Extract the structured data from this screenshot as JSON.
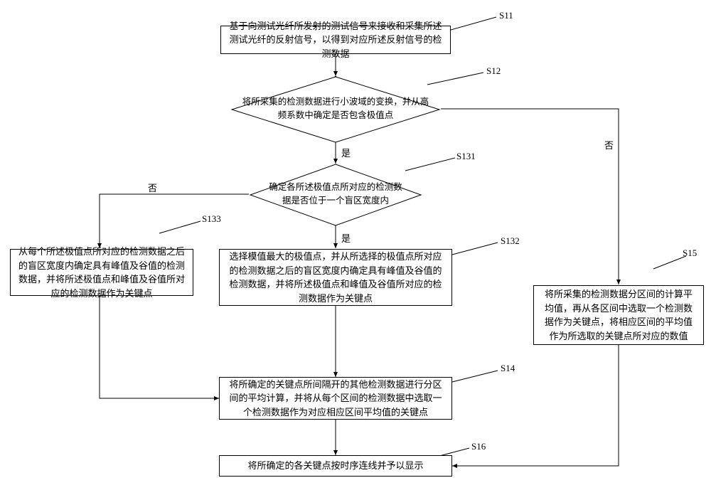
{
  "chart_data": {
    "type": "flowchart",
    "title": "",
    "nodes": [
      {
        "id": "S11",
        "type": "process",
        "label": "基于向测试光纤所发射的测试信号来接收和采集所述测试光纤的反射信号，以得到对应所述反射信号的检测数据"
      },
      {
        "id": "S12",
        "type": "decision",
        "label": "将所采集的检测数据进行小波域的变换，并从高频系数中确定是否包含极值点"
      },
      {
        "id": "S131",
        "type": "decision",
        "label": "确定各所述极值点所对应的检测数据是否位于一个盲区宽度内"
      },
      {
        "id": "S132",
        "type": "process",
        "label": "选择模值最大的极值点，并从所选择的极值点所对应的检测数据之后的盲区宽度内确定具有峰值及谷值的检测数据，并将所述极值点和峰值及谷值所对应的检测数据作为关键点"
      },
      {
        "id": "S133",
        "type": "process",
        "label": "从每个所述极值点所对应的检测数据之后的盲区宽度内确定具有峰值及谷值的检测数据，并将所述极值点和峰值及谷值所对应的检测数据作为关键点"
      },
      {
        "id": "S14",
        "type": "process",
        "label": "将所确定的关键点所间隔开的其他检测数据进行分区间的平均计算，并将从每个区间的检测数据中选取一个检测数据作为对应相应区间平均值的关键点"
      },
      {
        "id": "S15",
        "type": "process",
        "label": "将所采集的检测数据分区间的计算平均值，再从各区间中选取一个检测数据作为关键点，将相应区间的平均值作为所选取的关键点所对应的数值"
      },
      {
        "id": "S16",
        "type": "process",
        "label": "将所确定的各关键点按时序连线并予以显示"
      }
    ],
    "edges": [
      {
        "from": "S11",
        "to": "S12",
        "label": ""
      },
      {
        "from": "S12",
        "to": "S131",
        "label": "是"
      },
      {
        "from": "S12",
        "to": "S15",
        "label": "否"
      },
      {
        "from": "S131",
        "to": "S132",
        "label": "是"
      },
      {
        "from": "S131",
        "to": "S133",
        "label": "否"
      },
      {
        "from": "S132",
        "to": "S14",
        "label": ""
      },
      {
        "from": "S133",
        "to": "S14",
        "label": ""
      },
      {
        "from": "S14",
        "to": "S16",
        "label": ""
      },
      {
        "from": "S15",
        "to": "S16",
        "label": ""
      }
    ]
  },
  "labels": {
    "yes": "是",
    "no": "否",
    "s11": "S11",
    "s12": "S12",
    "s131": "S131",
    "s132": "S132",
    "s133": "S133",
    "s14": "S14",
    "s15": "S15",
    "s16": "S16"
  }
}
